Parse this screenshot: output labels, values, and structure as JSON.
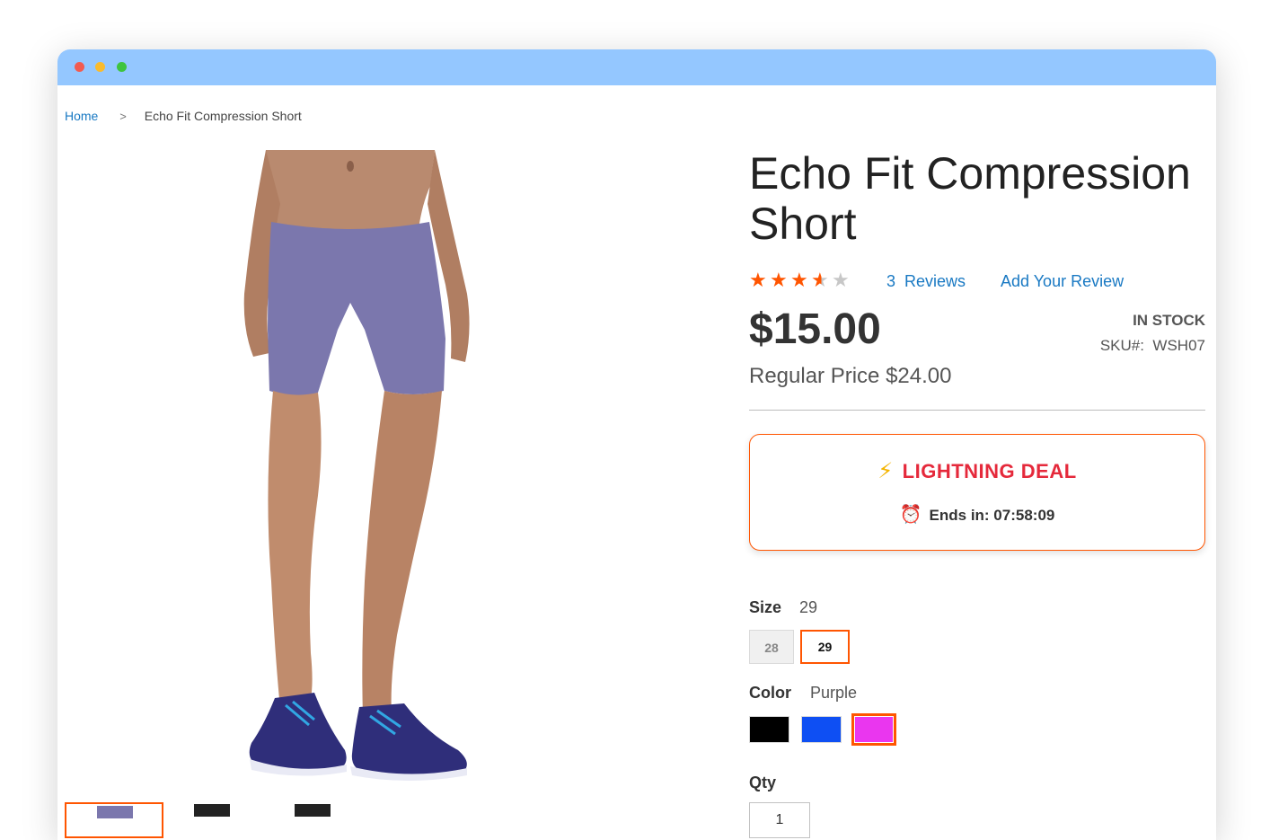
{
  "window": {
    "traffic_lights": [
      "close",
      "minimize",
      "zoom"
    ]
  },
  "breadcrumb": {
    "home": "Home",
    "separator": ">",
    "current": "Echo Fit Compression Short"
  },
  "product": {
    "title": "Echo Fit Compression Short",
    "rating": 3.5,
    "rating_max": 5,
    "reviews_link": "3  Reviews",
    "add_review_link": "Add Your Review",
    "price": "$15.00",
    "regular_price": "Regular Price $24.00",
    "stock": "IN STOCK",
    "sku": "SKU#:  WSH07",
    "image_icon": "product-photo-purple-shorts"
  },
  "deal": {
    "title": "LIGHTNING DEAL",
    "bolt_icon": "⚡",
    "ends_in": "Ends in: 07:58:09",
    "clock_icon": "⏰",
    "accent": "#e5293b",
    "border": "#ff5501"
  },
  "options": {
    "size_label": "Size",
    "size_selected": "29",
    "sizes": [
      "28",
      "29"
    ],
    "color_label": "Color",
    "color_selected": "Purple",
    "colors": [
      {
        "name": "Black",
        "hex": "#000000"
      },
      {
        "name": "Blue",
        "hex": "#0e4ff3"
      },
      {
        "name": "Purple",
        "hex": "#ea36ef"
      }
    ],
    "qty_label": "Qty",
    "qty_value": "1"
  },
  "theme": {
    "accent": "#ff5501",
    "link": "#1979c3",
    "titlebar": "#94c7ff"
  }
}
